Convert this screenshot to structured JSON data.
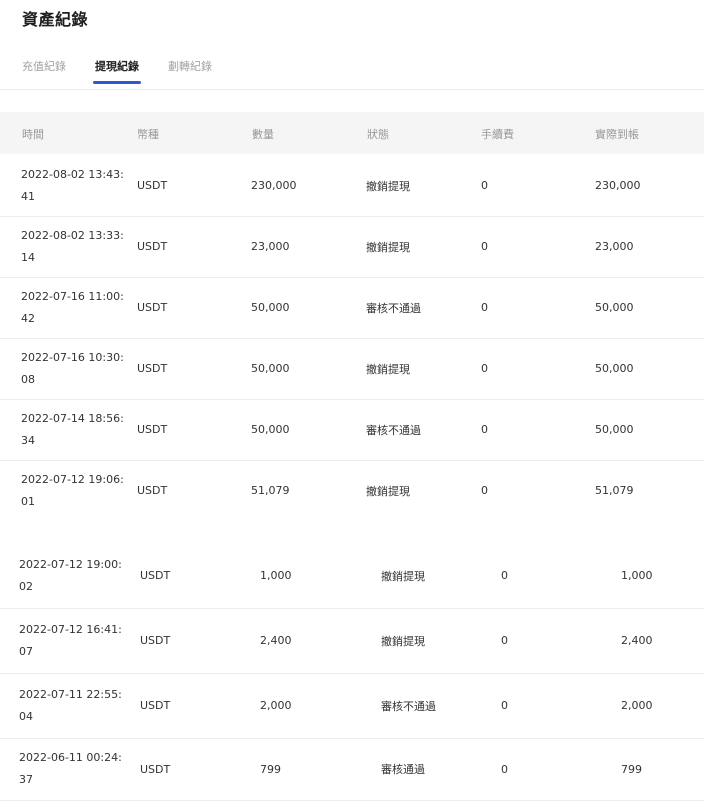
{
  "title": "資產紀錄",
  "tabs": [
    {
      "label": "充值紀錄",
      "active": false
    },
    {
      "label": "提現紀錄",
      "active": true
    },
    {
      "label": "劃轉紀錄",
      "active": false
    }
  ],
  "accent_color": "#2f57d6",
  "table": {
    "columns": [
      "時間",
      "幣種",
      "數量",
      "狀態",
      "手續費",
      "實際到帳"
    ],
    "rows": [
      {
        "time": "2022-08-02 13:43:41",
        "coin": "USDT",
        "amount": "230,000",
        "status": "撤銷提現",
        "fee": "0",
        "received": "230,000"
      },
      {
        "time": "2022-08-02 13:33:14",
        "coin": "USDT",
        "amount": "23,000",
        "status": "撤銷提現",
        "fee": "0",
        "received": "23,000"
      },
      {
        "time": "2022-07-16 11:00:42",
        "coin": "USDT",
        "amount": "50,000",
        "status": "審核不通過",
        "fee": "0",
        "received": "50,000"
      },
      {
        "time": "2022-07-16 10:30:08",
        "coin": "USDT",
        "amount": "50,000",
        "status": "撤銷提現",
        "fee": "0",
        "received": "50,000"
      },
      {
        "time": "2022-07-14 18:56:34",
        "coin": "USDT",
        "amount": "50,000",
        "status": "審核不通過",
        "fee": "0",
        "received": "50,000"
      },
      {
        "time": "2022-07-12 19:06:01",
        "coin": "USDT",
        "amount": "51,079",
        "status": "撤銷提現",
        "fee": "0",
        "received": "51,079"
      },
      {
        "time": "2022-07-12 19:00:02",
        "coin": "USDT",
        "amount": "1,000",
        "status": "撤銷提現",
        "fee": "0",
        "received": "1,000"
      },
      {
        "time": "2022-07-12 16:41:07",
        "coin": "USDT",
        "amount": "2,400",
        "status": "撤銷提現",
        "fee": "0",
        "received": "2,400"
      },
      {
        "time": "2022-07-11 22:55:04",
        "coin": "USDT",
        "amount": "2,000",
        "status": "審核不通過",
        "fee": "0",
        "received": "2,000"
      },
      {
        "time": "2022-06-11 00:24:37",
        "coin": "USDT",
        "amount": "799",
        "status": "審核通過",
        "fee": "0",
        "received": "799"
      }
    ]
  }
}
